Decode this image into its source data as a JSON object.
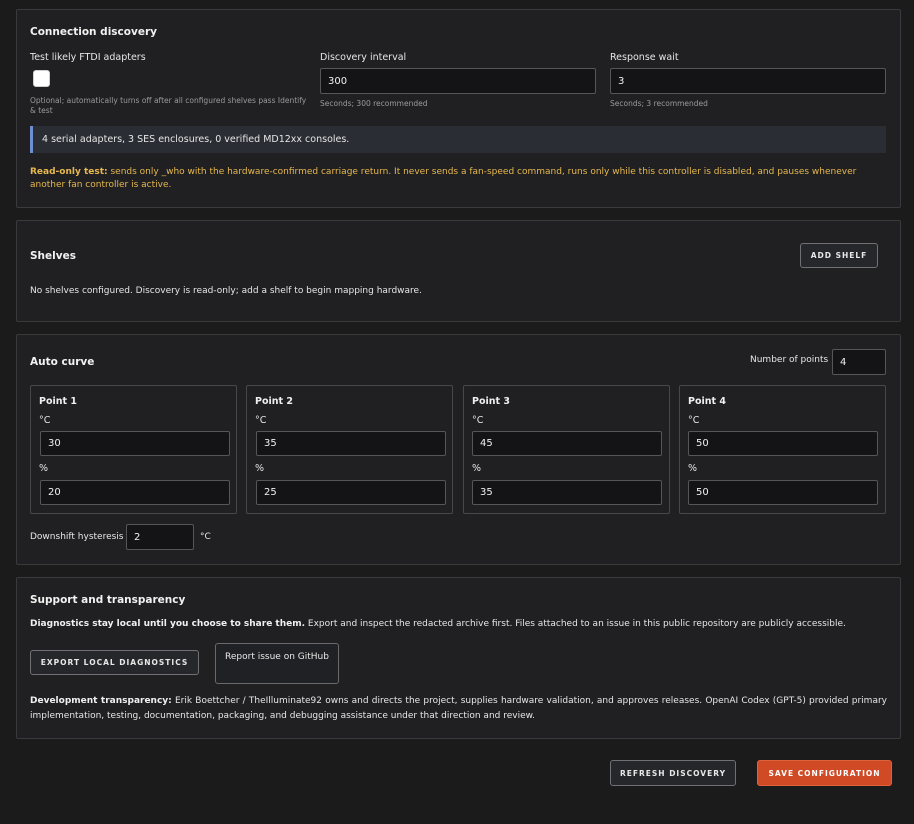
{
  "connection": {
    "title": "Connection discovery",
    "ftdi_label": "Test likely FTDI adapters",
    "ftdi_checked": false,
    "ftdi_hint": "Optional; automatically turns off after all configured shelves pass Identify & test",
    "interval_label": "Discovery interval",
    "interval_value": "300",
    "interval_hint": "Seconds; 300 recommended",
    "wait_label": "Response wait",
    "wait_value": "3",
    "wait_hint": "Seconds; 3 recommended",
    "status": "4 serial adapters, 3 SES enclosures, 0 verified MD12xx consoles.",
    "readonly_strong": "Read-only test:",
    "readonly_text": " sends only _who with the hardware-confirmed carriage return. It never sends a fan-speed command, runs only while this controller is disabled, and pauses whenever another fan controller is active.",
    "warn_color": "#e6b84e"
  },
  "shelves": {
    "title": "Shelves",
    "add_label": "ADD SHELF",
    "empty_text": "No shelves configured. Discovery is read-only; add a shelf to begin mapping hardware."
  },
  "curve": {
    "title": "Auto curve",
    "num_points_label": "Number of points",
    "num_points_value": "4",
    "points": [
      {
        "title": "Point 1",
        "temp_unit": "°C",
        "temp": "30",
        "pct_unit": "%",
        "pct": "20"
      },
      {
        "title": "Point 2",
        "temp_unit": "°C",
        "temp": "35",
        "pct_unit": "%",
        "pct": "25"
      },
      {
        "title": "Point 3",
        "temp_unit": "°C",
        "temp": "45",
        "pct_unit": "%",
        "pct": "35"
      },
      {
        "title": "Point 4",
        "temp_unit": "°C",
        "temp": "50",
        "pct_unit": "%",
        "pct": "50"
      }
    ],
    "hysteresis_label": "Downshift hysteresis",
    "hysteresis_value": "2",
    "hysteresis_unit": "°C"
  },
  "support": {
    "title": "Support and transparency",
    "privacy_strong": "Diagnostics stay local until you choose to share them.",
    "privacy_text": " Export and inspect the redacted archive first. Files attached to an issue in this public repository are publicly accessible.",
    "export_label": "EXPORT LOCAL DIAGNOSTICS",
    "report_label": "Report issue on GitHub",
    "dev_strong": "Development transparency:",
    "dev_text": " Erik Boettcher / TheIlluminate92 owns and directs the project, supplies hardware validation, and approves releases. OpenAI Codex (GPT-5) provided primary implementation, testing, documentation, packaging, and debugging assistance under that direction and review."
  },
  "footer": {
    "refresh_label": "REFRESH DISCOVERY",
    "save_label": "SAVE CONFIGURATION",
    "accent_color": "#cf4a25"
  }
}
